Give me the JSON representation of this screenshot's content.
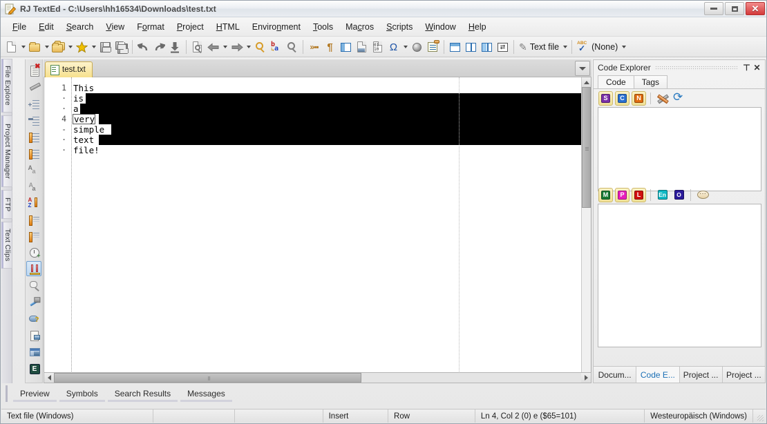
{
  "window": {
    "title": "RJ TextEd - C:\\Users\\hh16534\\Downloads\\test.txt",
    "icon": "notepad-pencil-icon",
    "minimize_label": "",
    "maximize_label": "",
    "close_label": "✕"
  },
  "menubar": {
    "items": [
      {
        "label": "File",
        "accel": "F"
      },
      {
        "label": "Edit",
        "accel": "E"
      },
      {
        "label": "Search",
        "accel": "S"
      },
      {
        "label": "View",
        "accel": "V"
      },
      {
        "label": "Format",
        "accel": "o"
      },
      {
        "label": "Project",
        "accel": "P"
      },
      {
        "label": "HTML",
        "accel": "H"
      },
      {
        "label": "Environment",
        "accel": "n"
      },
      {
        "label": "Tools",
        "accel": "T"
      },
      {
        "label": "Macros",
        "accel": "c"
      },
      {
        "label": "Scripts",
        "accel": "S"
      },
      {
        "label": "Window",
        "accel": "W"
      },
      {
        "label": "Help",
        "accel": "H"
      }
    ]
  },
  "toolbar": {
    "icons": [
      "new-file-icon",
      "new-folder-icon",
      "open-files-icon",
      "favorites-star-icon",
      "save-icon",
      "save-all-icon",
      "undo-icon",
      "redo-icon",
      "save-to-disk-icon",
      "print-preview-icon",
      "navigate-back-icon",
      "navigate-forward-icon",
      "find-icon",
      "replace-icon",
      "search-in-files-icon",
      "more-commands-icon",
      "show-formatting-marks-icon",
      "toggle-panels-icon",
      "insert-image-icon",
      "hex-editor-icon",
      "special-characters-icon",
      "web-preview-icon",
      "snippets-icon",
      "split-horizontal-icon",
      "split-vertical-icon",
      "split-columns-icon",
      "compare-files-icon"
    ],
    "filetype_combo": {
      "value": "Text file",
      "icon": "quill-icon"
    },
    "spellcheck_combo": {
      "value": "(None)",
      "icon": "spellcheck-abc-icon"
    }
  },
  "left_dock": {
    "tabs": [
      {
        "label": "File Explore"
      },
      {
        "label": "Project Manager"
      },
      {
        "label": "FTP"
      },
      {
        "label": "Text Clips"
      }
    ]
  },
  "left_toolbar": {
    "icons": [
      {
        "name": "delete-document-icon",
        "selected": false
      },
      {
        "name": "edit-pencil-icon",
        "selected": false
      },
      {
        "name": "increase-indent-icon",
        "selected": false
      },
      {
        "name": "decrease-indent-icon",
        "selected": false
      },
      {
        "name": "move-line-up-icon",
        "selected": false
      },
      {
        "name": "move-line-down-icon",
        "selected": false
      },
      {
        "name": "uppercase-icon",
        "selected": false
      },
      {
        "name": "lowercase-icon",
        "selected": false
      },
      {
        "name": "sort-a-z-icon",
        "selected": false
      },
      {
        "name": "sort-ascending-icon",
        "selected": false
      },
      {
        "name": "sort-descending-icon",
        "selected": false
      },
      {
        "name": "history-clock-icon",
        "selected": false
      },
      {
        "name": "column-mode-icon",
        "selected": true
      },
      {
        "name": "find-in-selection-icon",
        "selected": false
      },
      {
        "name": "build-hammer-icon",
        "selected": false
      },
      {
        "name": "cloud-help-icon",
        "selected": false
      },
      {
        "name": "document-key-icon",
        "selected": false
      },
      {
        "name": "window-snapshot-icon",
        "selected": false
      },
      {
        "name": "editor-e-icon",
        "selected": false
      }
    ]
  },
  "editor": {
    "tab": {
      "label": "test.txt",
      "icon": "text-document-icon",
      "active": true
    },
    "tab_dropdown_icon": "chevron-down-icon",
    "gutter": [
      "1",
      "·",
      "·",
      "4",
      "-",
      "·",
      "·"
    ],
    "lines": [
      "This",
      "is",
      "a",
      "very",
      "simple",
      "text",
      "file!"
    ],
    "cursor_line_index": 3,
    "cursor_word": "very",
    "selection_lines": [
      1,
      2,
      3,
      4,
      5
    ],
    "selection_color": "#000000",
    "background_color": "#ffffff",
    "text_color": "#000000"
  },
  "code_explorer": {
    "title": "Code Explorer",
    "pin_icon": "pin-icon",
    "close_icon": "close-icon",
    "tabs": [
      {
        "label": "Code",
        "active": true
      },
      {
        "label": "Tags",
        "active": false
      }
    ],
    "top_buttons": [
      {
        "label": "S",
        "color": "#7a2fa8",
        "name": "scope-filter-button"
      },
      {
        "label": "C",
        "color": "#2a6fd0",
        "name": "class-filter-button"
      },
      {
        "label": "N",
        "color": "#e06c10",
        "name": "namespace-filter-button"
      }
    ],
    "top_tools": [
      "settings-wrench-icon",
      "refresh-icon"
    ],
    "bottom_buttons": [
      {
        "label": "M",
        "color": "#187a33",
        "name": "method-filter-button"
      },
      {
        "label": "P",
        "color": "#e81ebd",
        "name": "property-filter-button"
      },
      {
        "label": "L",
        "color": "#d01010",
        "name": "local-filter-button"
      }
    ],
    "bottom_plain_buttons": [
      {
        "label": "En",
        "color": "#0fb8c4",
        "name": "enum-filter-button"
      },
      {
        "label": "O",
        "color": "#2a1a9a",
        "name": "object-filter-button"
      }
    ],
    "bottom_tools": [
      "comment-bubble-icon"
    ],
    "dock_tabs": [
      {
        "label": "Docum...",
        "active": false
      },
      {
        "label": "Code E...",
        "active": true
      },
      {
        "label": "Project ...",
        "active": false
      },
      {
        "label": "Project ...",
        "active": false
      }
    ]
  },
  "bottom_panel": {
    "tabs": [
      {
        "label": "Preview"
      },
      {
        "label": "Symbols"
      },
      {
        "label": "Search Results"
      },
      {
        "label": "Messages"
      }
    ]
  },
  "statusbar": {
    "filetype": "Text file (Windows)",
    "field2": "",
    "field3": "",
    "insert_mode": "Insert",
    "select_mode": "Row",
    "caret": "Ln 4, Col 2 (0) e ($65=101)",
    "encoding": "Westeuropäisch (Windows)"
  },
  "colors": {
    "accent": "#2a7ac0",
    "tab_active": "#f6e08d",
    "selection": "#000000",
    "close_button": "#d33a3a"
  }
}
